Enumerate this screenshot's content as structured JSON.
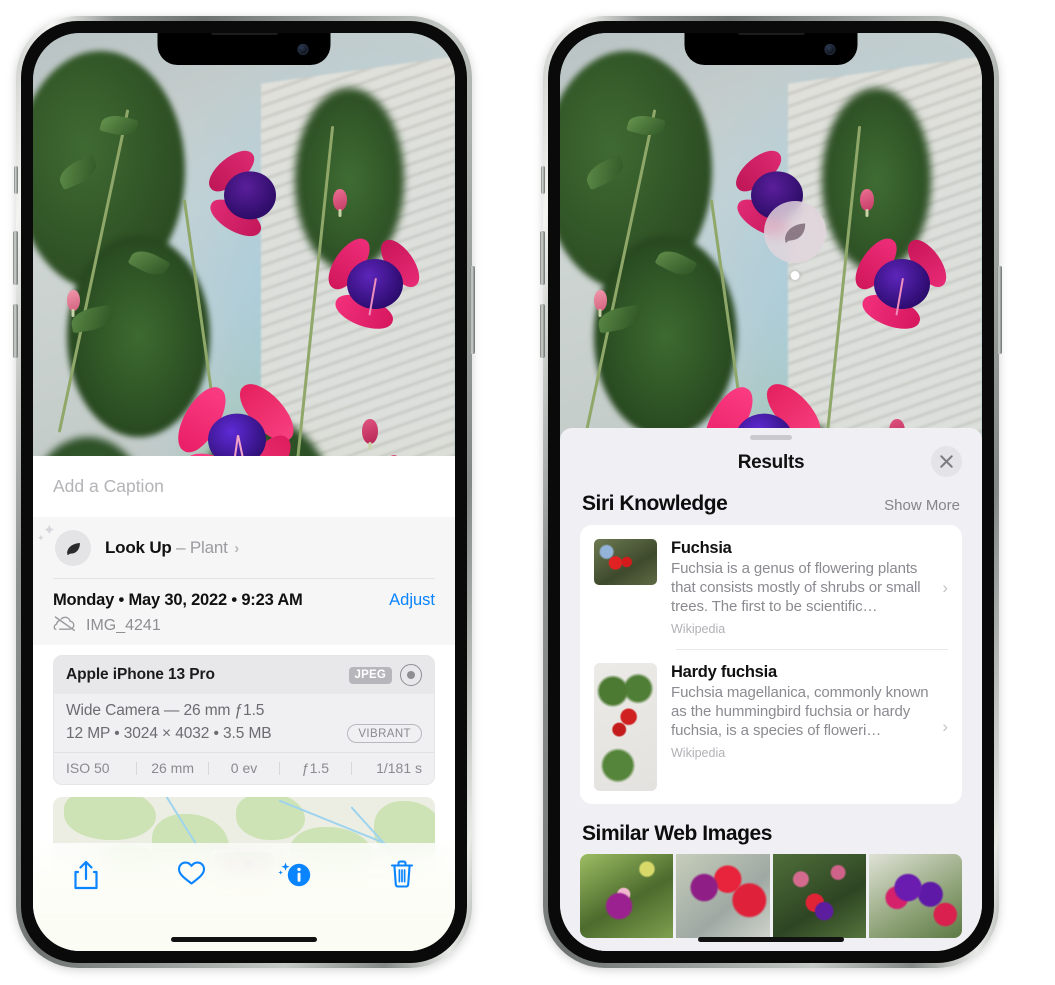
{
  "left_phone": {
    "caption_placeholder": "Add a Caption",
    "lookup": {
      "label": "Look Up",
      "dash": "–",
      "subject": "Plant",
      "chevron": "›",
      "icon": "leaf-icon"
    },
    "metadata": {
      "date": "Monday • May 30, 2022 • 9:23 AM",
      "adjust_label": "Adjust",
      "filename": "IMG_4241",
      "cloud_icon": "icloud-slash-icon"
    },
    "camera_card": {
      "model": "Apple iPhone 13 Pro",
      "format_badge": "JPEG",
      "raw_icon": "raw-circle-icon",
      "lens": "Wide Camera — 26 mm ƒ1.5",
      "specs": "12 MP • 3024 × 4032 • 3.5 MB",
      "profile_badge": "VIBRANT",
      "exif": [
        "ISO 50",
        "26 mm",
        "0 ev",
        "ƒ1.5",
        "1/181 s"
      ]
    },
    "toolbar": {
      "share_label": "Share",
      "favorite_label": "Favorite",
      "info_label": "Info",
      "delete_label": "Delete"
    }
  },
  "right_phone": {
    "visual_lookup_badge": "leaf-icon",
    "results": {
      "title": "Results",
      "close_label": "Close",
      "sections": [
        {
          "title": "Siri Knowledge",
          "action": "Show More",
          "items": [
            {
              "title": "Fuchsia",
              "description": "Fuchsia is a genus of flowering plants that consists mostly of shrubs or small trees. The first to be scientific…",
              "source": "Wikipedia",
              "chevron": "›"
            },
            {
              "title": "Hardy fuchsia",
              "description": "Fuchsia magellanica, commonly known as the hummingbird fuchsia or hardy fuchsia, is a species of floweri…",
              "source": "Wikipedia",
              "chevron": "›"
            }
          ]
        },
        {
          "title": "Similar Web Images",
          "items": [
            {
              "alt": "fuchsia-web-image-1"
            },
            {
              "alt": "fuchsia-web-image-2"
            },
            {
              "alt": "fuchsia-web-image-3"
            },
            {
              "alt": "fuchsia-web-image-4"
            }
          ]
        }
      ]
    }
  },
  "colors": {
    "accent_blue": "#0a84ff",
    "sheet_bg": "#f6f6f7",
    "results_bg": "#f0eff4",
    "secondary_text": "#8e8e93"
  }
}
